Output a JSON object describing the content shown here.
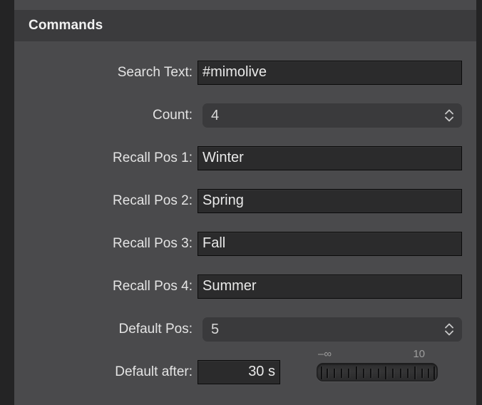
{
  "panel": {
    "title": "Commands"
  },
  "theme": {
    "panel_bg": "#4a4a4c",
    "header_bg": "#3b3b3d",
    "gutter_bg": "#242425",
    "field_bg": "#2b2b2c",
    "stepper_bg": "#3a3a3c",
    "label_color": "#e4e4e4",
    "value_color": "#e9e9e9",
    "tick_label_color": "#9d9d9d"
  },
  "rows": [
    {
      "key": "search_text",
      "label": "Search Text:",
      "type": "textfield",
      "value": "#mimolive",
      "placeholder": ""
    },
    {
      "key": "count",
      "label": "Count:",
      "type": "stepper",
      "value": "4"
    },
    {
      "key": "recall_pos_1",
      "label": "Recall Pos 1:",
      "type": "textfield",
      "value": "Winter",
      "placeholder": ""
    },
    {
      "key": "recall_pos_2",
      "label": "Recall Pos 2:",
      "type": "textfield",
      "value": "Spring",
      "placeholder": ""
    },
    {
      "key": "recall_pos_3",
      "label": "Recall Pos 3:",
      "type": "textfield",
      "value": "Fall",
      "placeholder": ""
    },
    {
      "key": "recall_pos_4",
      "label": "Recall Pos 4:",
      "type": "textfield",
      "value": "Summer",
      "placeholder": ""
    },
    {
      "key": "default_pos",
      "label": "Default Pos:",
      "type": "stepper",
      "value": "5"
    },
    {
      "key": "default_after",
      "label": "Default after:",
      "type": "textfield_with_slider",
      "value": "30 s",
      "placeholder": ""
    }
  ],
  "slider": {
    "min_label": "–∞",
    "max_label": "10",
    "icon": "tick-scale-icon"
  },
  "icons": {
    "stepper": "chevron-up-down-icon"
  }
}
